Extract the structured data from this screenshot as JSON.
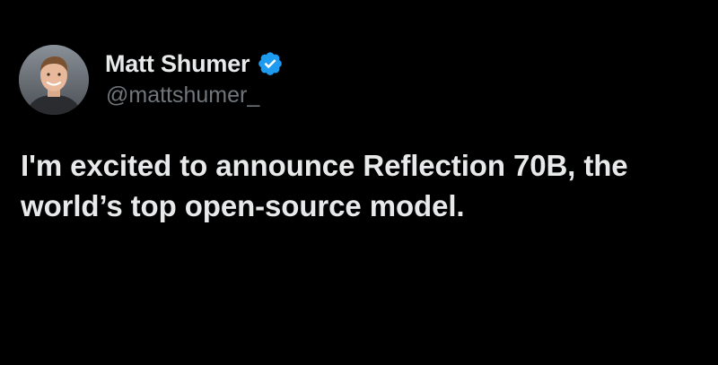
{
  "author": {
    "display_name": "Matt Shumer",
    "handle": "@mattshumer_",
    "verified": true,
    "verified_icon": "verified-badge-icon",
    "verified_color": "#1d9bf0",
    "avatar_icon": "profile-photo"
  },
  "tweet": {
    "text": "I'm excited to announce Reflection 70B, the world’s top open-source model."
  },
  "colors": {
    "background": "#000000",
    "primary_text": "#e7e9ea",
    "secondary_text": "#71767b"
  }
}
